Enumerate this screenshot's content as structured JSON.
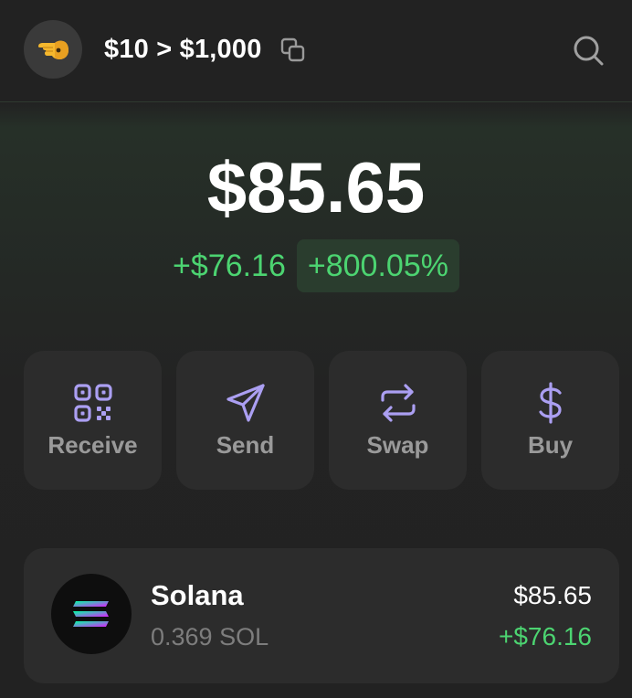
{
  "header": {
    "account_name": "$10 > $1,000",
    "avatar_icon": "pointing-hand-emoji-icon",
    "copy_icon": "copy-icon",
    "search_icon": "search-icon"
  },
  "balance": {
    "total": "$85.65",
    "change_amount": "+$76.16",
    "change_percent": "+800.05%"
  },
  "actions": [
    {
      "label": "Receive",
      "icon": "qr-code-icon"
    },
    {
      "label": "Send",
      "icon": "send-icon"
    },
    {
      "label": "Swap",
      "icon": "swap-icon"
    },
    {
      "label": "Buy",
      "icon": "dollar-icon"
    }
  ],
  "tokens": [
    {
      "name": "Solana",
      "amount": "0.369 SOL",
      "value": "$85.65",
      "change": "+$76.16",
      "icon": "solana-logo-icon"
    }
  ],
  "colors": {
    "background": "#222222",
    "card": "#2c2c2c",
    "positive": "#4cd471",
    "positive_badge_bg": "#2a3d2e",
    "accent_purple": "#ab9ff2",
    "muted_text": "#9a9a9a"
  }
}
